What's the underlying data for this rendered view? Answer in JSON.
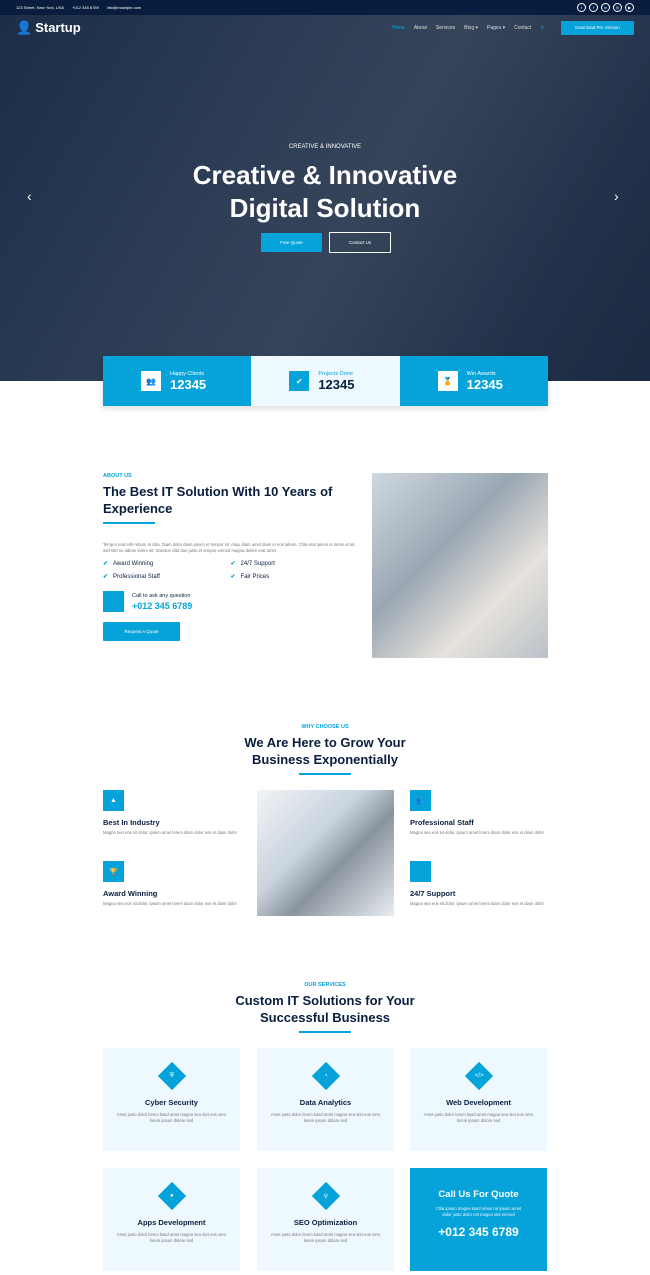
{
  "topbar": {
    "address": "123 Street, New York, USA",
    "phone": "+012 345 6789",
    "email": "info@example.com",
    "social": [
      "twitter-icon",
      "facebook-icon",
      "linkedin-icon",
      "instagram-icon",
      "youtube-icon"
    ]
  },
  "nav": {
    "brand": "Startup",
    "items": [
      "Home",
      "About",
      "Services",
      "Blog ▾",
      "Pages ▾",
      "Contact"
    ],
    "cta": "Download Pro Version"
  },
  "hero": {
    "kicker": "CREATIVE & INNOVATIVE",
    "title1": "Creative & Innovative",
    "title2": "Digital Solution",
    "btn1": "Free Quote",
    "btn2": "Contact Us"
  },
  "stats": [
    {
      "label": "Happy Clients",
      "value": "12345",
      "icon": "users-icon"
    },
    {
      "label": "Projects Done",
      "value": "12345",
      "icon": "check-icon"
    },
    {
      "label": "Win Awards",
      "value": "12345",
      "icon": "award-icon"
    }
  ],
  "about": {
    "sub": "ABOUT US",
    "title": "The Best IT Solution With 10 Years of Experience",
    "text": "Tempor erat elitr rebum at clita. Diam dolor diam ipsum et tempor sit. Aliqu diam amet diam et eos labore. Clita erat ipsum et lorem et sit, sed stet no labore lorem sit. Sanctus clita duo justo et tempor eirmod magna dolore erat amet",
    "checks": [
      "Award Winning",
      "24/7 Support",
      "Professional Staff",
      "Fair Prices"
    ],
    "call_label": "Call to ask any question",
    "call_number": "+012 345 6789",
    "button": "Request A Quote"
  },
  "why": {
    "sub": "WHY CHOOSE US",
    "title1": "We Are Here to Grow Your",
    "title2": "Business Exponentially",
    "features": [
      {
        "title": "Best In Industry",
        "text": "Magna sea eos sit dolor, ipsum amet lorem diam dolor eos et diam dolor"
      },
      {
        "title": "Award Winning",
        "text": "Magna sea eos sit dolor, ipsum amet lorem diam dolor eos et diam dolor"
      },
      {
        "title": "Professional Staff",
        "text": "Magna sea eos sit dolor, ipsum amet lorem diam dolor eos et diam dolor"
      },
      {
        "title": "24/7 Support",
        "text": "Magna sea eos sit dolor, ipsum amet lorem diam dolor eos et diam dolor"
      }
    ]
  },
  "services": {
    "sub": "OUR SERVICES",
    "title1": "Custom IT Solutions for Your",
    "title2": "Successful Business",
    "items": [
      {
        "title": "Cyber Security",
        "text": "Amet justo dolor lorem kasd amet magna sea stet eos vero lorem ipsum dolore sed"
      },
      {
        "title": "Data Analytics",
        "text": "Amet justo dolor lorem kasd amet magna sea stet eos vero lorem ipsum dolore sed"
      },
      {
        "title": "Web Development",
        "text": "Amet justo dolor lorem kasd amet magna sea stet eos vero lorem ipsum dolore sed"
      },
      {
        "title": "Apps Development",
        "text": "Amet justo dolor lorem kasd amet magna sea stet eos vero lorem ipsum dolore sed"
      },
      {
        "title": "SEO Optimization",
        "text": "Amet justo dolor lorem kasd amet magna sea stet eos vero lorem ipsum dolore sed"
      }
    ],
    "quote": {
      "title": "Call Us For Quote",
      "text": "Clita ipsum magna kasd rebum at ipsum amet dolor justo dolor est magna stet eirmod",
      "number": "+012 345 6789"
    }
  },
  "colors": {
    "primary": "#06A3DA",
    "dark": "#091E3E",
    "light": "#EEF9FF"
  }
}
